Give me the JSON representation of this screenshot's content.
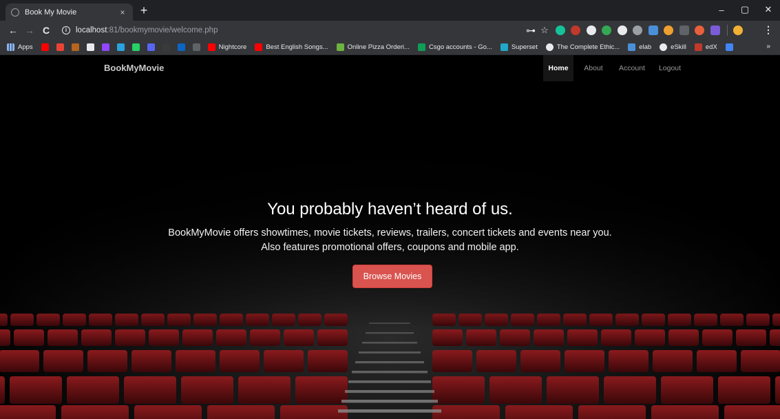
{
  "browser": {
    "tab_title": "Book My Movie",
    "tab_close": "×",
    "new_tab": "+",
    "window_controls": {
      "minimize": "–",
      "maximize": "▢",
      "close": "✕"
    },
    "nav": {
      "back": "←",
      "forward": "→",
      "reload": "C"
    },
    "url": {
      "host": "localhost",
      "path": ":81/bookmymovie/welcome.php"
    },
    "info_icon_glyph": "i",
    "key_icon_glyph": "⊶",
    "star_icon_glyph": "☆",
    "menu_glyph": "⋮",
    "extensions": [
      {
        "icon": "grammarly-icon",
        "color": "#15c39a"
      },
      {
        "icon": "ublock-icon",
        "color": "#c0392b"
      },
      {
        "icon": "play-icon",
        "color": "#e8eaed"
      },
      {
        "icon": "puzzle-green-icon",
        "color": "#34a853"
      },
      {
        "icon": "check-icon",
        "color": "#e8eaed"
      },
      {
        "icon": "google-icon",
        "color": "#9aa0a6"
      },
      {
        "icon": "translate-icon",
        "color": "#4a90d9"
      },
      {
        "icon": "pinwheel-icon",
        "color": "#f0a030"
      },
      {
        "icon": "clipboard-icon",
        "color": "#5f6368"
      },
      {
        "icon": "fire-icon",
        "color": "#e8603c"
      },
      {
        "icon": "notes-icon",
        "color": "#7b5cd6"
      }
    ],
    "profile_color": "#f2b134"
  },
  "bookmarks": {
    "apps_label": "Apps",
    "icon_only": [
      {
        "icon": "youtube-icon",
        "color": "#ff0000"
      },
      {
        "icon": "gmail-icon",
        "color": "#ea4335"
      },
      {
        "icon": "codechef-icon",
        "color": "#b5651d"
      },
      {
        "icon": "chrome-icon",
        "color": "#e8eaed"
      },
      {
        "icon": "twitch-icon",
        "color": "#9146ff"
      },
      {
        "icon": "telegram-icon",
        "color": "#2aa3df"
      },
      {
        "icon": "whatsapp-icon",
        "color": "#25d366"
      },
      {
        "icon": "discord-icon",
        "color": "#5865f2"
      },
      {
        "icon": "github-icon",
        "color": "#3a3a3a"
      },
      {
        "icon": "linkedin-icon",
        "color": "#0a66c2"
      },
      {
        "icon": "circle-icon",
        "color": "#5f6368"
      }
    ],
    "items": [
      {
        "label": "Nightcore",
        "icon": "youtube-icon",
        "color": "#ff0000"
      },
      {
        "label": "Best English Songs...",
        "icon": "youtube-icon",
        "color": "#ff0000"
      },
      {
        "label": "Online Pizza Orderi...",
        "icon": "pizza-icon",
        "color": "#6db33f"
      },
      {
        "label": "Csgo accounts - Go...",
        "icon": "sheets-icon",
        "color": "#0f9d58"
      },
      {
        "label": "Superset",
        "icon": "superset-icon",
        "color": "#20a7c9"
      },
      {
        "label": "The Complete Ethic...",
        "icon": "globe-icon",
        "color": "#e8eaed"
      },
      {
        "label": "elab",
        "icon": "elab-icon",
        "color": "#4a90d9"
      },
      {
        "label": "eSkill",
        "icon": "globe-icon",
        "color": "#e8eaed"
      },
      {
        "label": "edX",
        "icon": "edx-icon",
        "color": "#c0392b"
      },
      {
        "label": "",
        "icon": "drive-icon",
        "color": "#4285f4"
      }
    ],
    "more": "»"
  },
  "site": {
    "brand": "BookMyMovie",
    "nav": [
      {
        "label": "Home",
        "active": true
      },
      {
        "label": "About",
        "active": false
      },
      {
        "label": "Account",
        "active": false
      },
      {
        "label": "Logout",
        "active": false
      }
    ]
  },
  "hero": {
    "title": "You probably haven’t heard of us.",
    "lead": "BookMyMovie offers showtimes, movie tickets, reviews, trailers, concert tickets and events near you. Also features promotional offers, coupons and mobile app.",
    "button": "Browse Movies"
  },
  "colors": {
    "primary_button": "#d9534f",
    "seat_red": "#6e1316"
  }
}
